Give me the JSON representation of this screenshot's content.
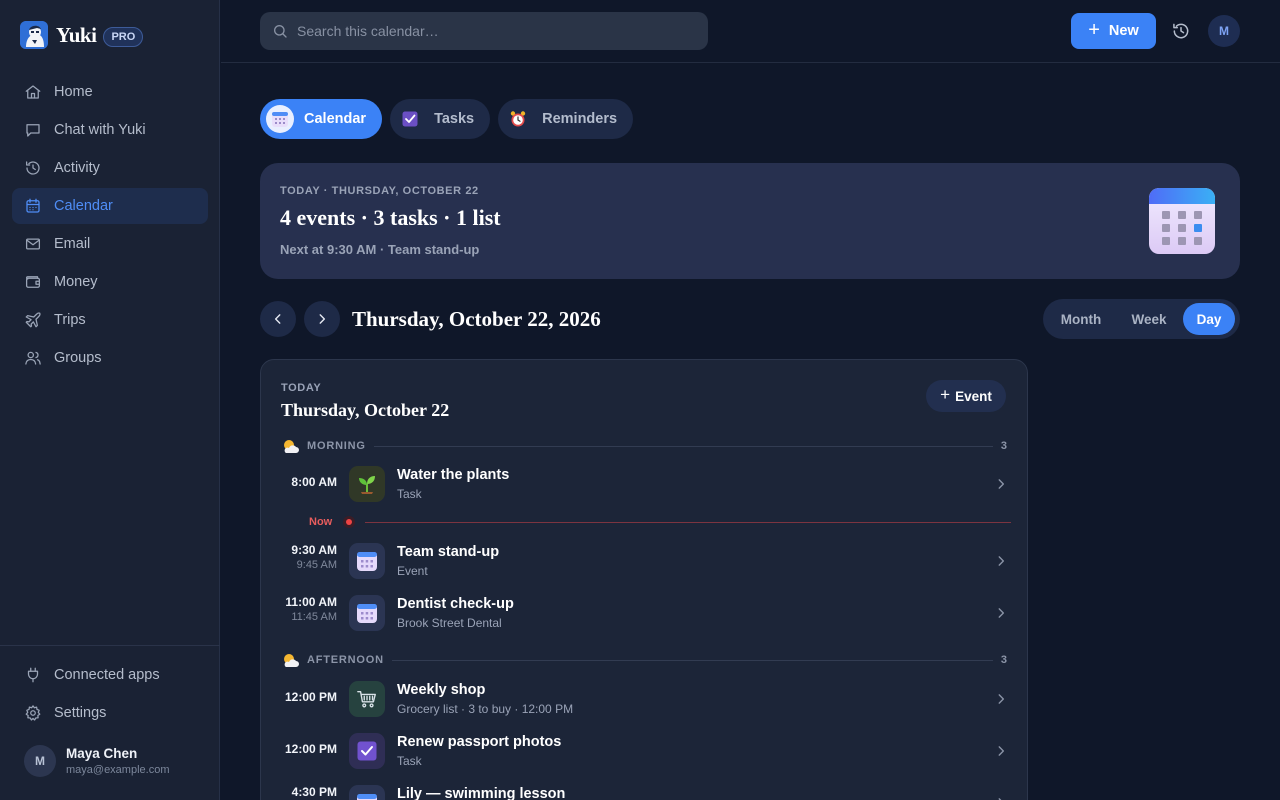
{
  "app": {
    "name": "Yuki",
    "badge": "PRO"
  },
  "sidebar": {
    "items": [
      {
        "label": "Home",
        "icon": "home-icon"
      },
      {
        "label": "Chat with Yuki",
        "icon": "chat-icon"
      },
      {
        "label": "Activity",
        "icon": "history-icon"
      },
      {
        "label": "Calendar",
        "icon": "calendar-icon",
        "active": true
      },
      {
        "label": "Email",
        "icon": "mail-icon"
      },
      {
        "label": "Money",
        "icon": "wallet-icon"
      },
      {
        "label": "Trips",
        "icon": "plane-icon"
      },
      {
        "label": "Groups",
        "icon": "users-icon"
      }
    ],
    "bottom": [
      {
        "label": "Connected apps",
        "icon": "plug-icon"
      },
      {
        "label": "Settings",
        "icon": "gear-icon"
      }
    ],
    "user": {
      "initial": "M",
      "name": "Maya Chen",
      "email": "maya@example.com"
    }
  },
  "topbar": {
    "search_placeholder": "Search this calendar…",
    "new_label": "New",
    "avatar_initial": "M"
  },
  "tabs": [
    {
      "label": "Calendar",
      "icon": "calendar-icon",
      "active": true
    },
    {
      "label": "Tasks",
      "icon": "checkbox-icon",
      "active": false
    },
    {
      "label": "Reminders",
      "icon": "alarm-clock-icon",
      "active": false
    }
  ],
  "summary": {
    "kicker": "TODAY · THURSDAY, OCTOBER 22",
    "title": "4 events · 3 tasks · 1 list",
    "next": "Next at 9:30 AM · Team stand-up"
  },
  "date_nav": {
    "title": "Thursday, October 22, 2026",
    "views": [
      "Month",
      "Week",
      "Day"
    ],
    "active_view": "Day"
  },
  "day": {
    "kicker": "TODAY",
    "title": "Thursday, October 22",
    "add_label": "Event",
    "now_label": "Now",
    "sections": [
      {
        "label": "MORNING",
        "count": "3",
        "icon": "sun-cloud-icon"
      },
      {
        "label": "AFTERNOON",
        "count": "3",
        "icon": "sun-cloud-icon"
      }
    ],
    "items": [
      {
        "start": "8:00 AM",
        "end": "",
        "title": "Water the plants",
        "subtitle": "Task",
        "icon": "seedling-icon"
      },
      {
        "start": "9:30 AM",
        "end": "9:45 AM",
        "title": "Team stand-up",
        "subtitle": "Event",
        "icon": "calendar-icon"
      },
      {
        "start": "11:00 AM",
        "end": "11:45 AM",
        "title": "Dentist check-up",
        "subtitle": "Brook Street Dental",
        "icon": "calendar-icon"
      },
      {
        "start": "12:00 PM",
        "end": "",
        "title": "Weekly shop",
        "subtitle": "Grocery list · 3 to buy · 12:00 PM",
        "icon": "cart-icon"
      },
      {
        "start": "12:00 PM",
        "end": "",
        "title": "Renew passport photos",
        "subtitle": "Task",
        "icon": "checkbox-icon"
      },
      {
        "start": "4:30 PM",
        "end": "",
        "title": "Lily — swimming lesson",
        "subtitle": "",
        "icon": "calendar-icon"
      }
    ]
  },
  "colors": {
    "accent": "#3b82f6",
    "background": "#0f1729",
    "sidebar": "#1a2234",
    "now_line": "#ef4444"
  }
}
